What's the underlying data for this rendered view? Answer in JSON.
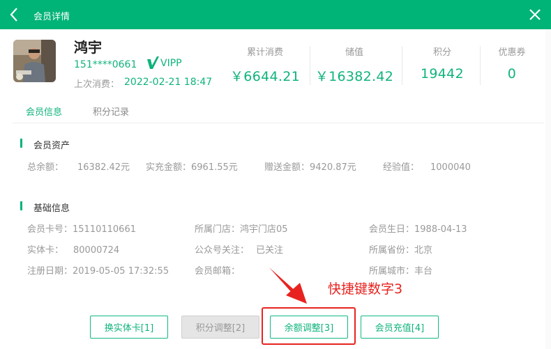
{
  "window": {
    "title": "会员详情"
  },
  "member": {
    "name": "鸿宇",
    "phone": "151****0661",
    "level": "VIPP",
    "last_consume_label": "上次消费：",
    "last_consume_time": "2022-02-21 18:47"
  },
  "stats": [
    {
      "label": "累计消费",
      "value": "￥6644.21"
    },
    {
      "label": "储值",
      "value": "￥16382.42"
    },
    {
      "label": "积分",
      "value": "19442"
    },
    {
      "label": "优惠券",
      "value": "0"
    }
  ],
  "tabs": [
    {
      "label": "会员信息",
      "active": true
    },
    {
      "label": "积分记录",
      "active": false
    }
  ],
  "assets": {
    "title": "会员资产",
    "fields": [
      {
        "label": "总余额：",
        "value": "16382.42元"
      },
      {
        "label": "实充金额：",
        "value": "6961.55元"
      },
      {
        "label": "赠送金额：",
        "value": "9420.87元"
      },
      {
        "label": "经验值：",
        "value": "1000040"
      }
    ]
  },
  "basic": {
    "title": "基础信息",
    "fields": [
      {
        "label": "会员卡号：",
        "value": "15110110661"
      },
      {
        "label": "所属门店：",
        "value": "鸿宇门店05"
      },
      {
        "label": "会员生日：",
        "value": "1988-04-13"
      },
      {
        "label": "实体卡：",
        "value": "80000724"
      },
      {
        "label": "公众号关注：",
        "value": "已关注"
      },
      {
        "label": "所属省份：",
        "value": "北京"
      },
      {
        "label": "注册日期：",
        "value": "2019-05-05 17:32:55"
      },
      {
        "label": "会员邮箱：",
        "value": ""
      },
      {
        "label": "所属城市：",
        "value": "丰台"
      }
    ]
  },
  "buttons": {
    "replace_card": "换实体卡[1]",
    "points_adjust": "积分调整[2]",
    "balance_adjust": "余额调整[3]",
    "recharge": "会员充值[4]"
  },
  "annotation": {
    "text": "快捷键数字3"
  },
  "colors": {
    "brand": "#00b377",
    "accent_text": "#0fb37d",
    "annotation": "#e8231f"
  },
  "icons": {
    "back": "chevron-left-icon",
    "close": "close-icon",
    "vip": "vip-check-icon"
  }
}
